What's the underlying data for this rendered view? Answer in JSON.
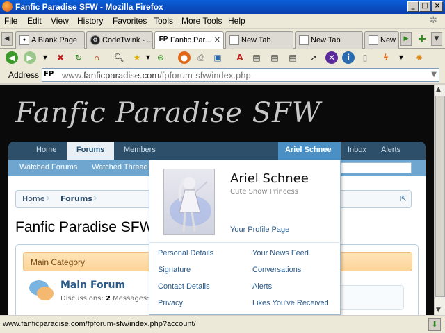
{
  "window": {
    "title": "Fanfic Paradise SFW - Mozilla Firefox"
  },
  "menu": [
    "File",
    "Edit",
    "View",
    "History",
    "Favorites",
    "Tools",
    "More Tools",
    "Help"
  ],
  "tabs": [
    {
      "label": "A Blank Page",
      "icon": "puzzle-icon"
    },
    {
      "label": "CodeTwink - ...",
      "icon": "cog-icon"
    },
    {
      "label": "Fanfic Par...",
      "icon": "fp-icon",
      "active": true
    },
    {
      "label": "New Tab",
      "icon": "page-icon"
    },
    {
      "label": "New Tab",
      "icon": "page-icon"
    },
    {
      "label": "New",
      "icon": "page-icon"
    }
  ],
  "address": {
    "label": "Address",
    "favicon": "FP",
    "url_prefix": "www.",
    "url_domain": "fanficparadise.com",
    "url_path": "/fpforum-sfw/index.php"
  },
  "page": {
    "site_title": "Fanfic Paradise SFW",
    "nav": {
      "home": "Home",
      "forums": "Forums",
      "members": "Members",
      "user": "Ariel Schnee",
      "inbox": "Inbox",
      "alerts": "Alerts"
    },
    "subnav": {
      "watched_forums": "Watched Forums",
      "watched_threads": "Watched Threads"
    },
    "breadcrumb": {
      "home": "Home",
      "forums": "Forums"
    },
    "title": "Fanfic Paradise SFW",
    "category": "Main Category",
    "forum": {
      "name": "Main Forum",
      "discussions_label": "Discussions:",
      "discussions": "2",
      "messages_label": "Messages:"
    }
  },
  "popup": {
    "name": "Ariel Schnee",
    "user_title": "Cute Snow Princess",
    "profile_link": "Your Profile Page",
    "links_left": [
      "Personal Details",
      "Signature",
      "Contact Details",
      "Privacy"
    ],
    "links_right": [
      "Your News Feed",
      "Conversations",
      "Alerts",
      "Likes You've Received"
    ]
  },
  "status": {
    "text": "www.fanficparadise.com/fpforum-sfw/index.php?account/"
  }
}
